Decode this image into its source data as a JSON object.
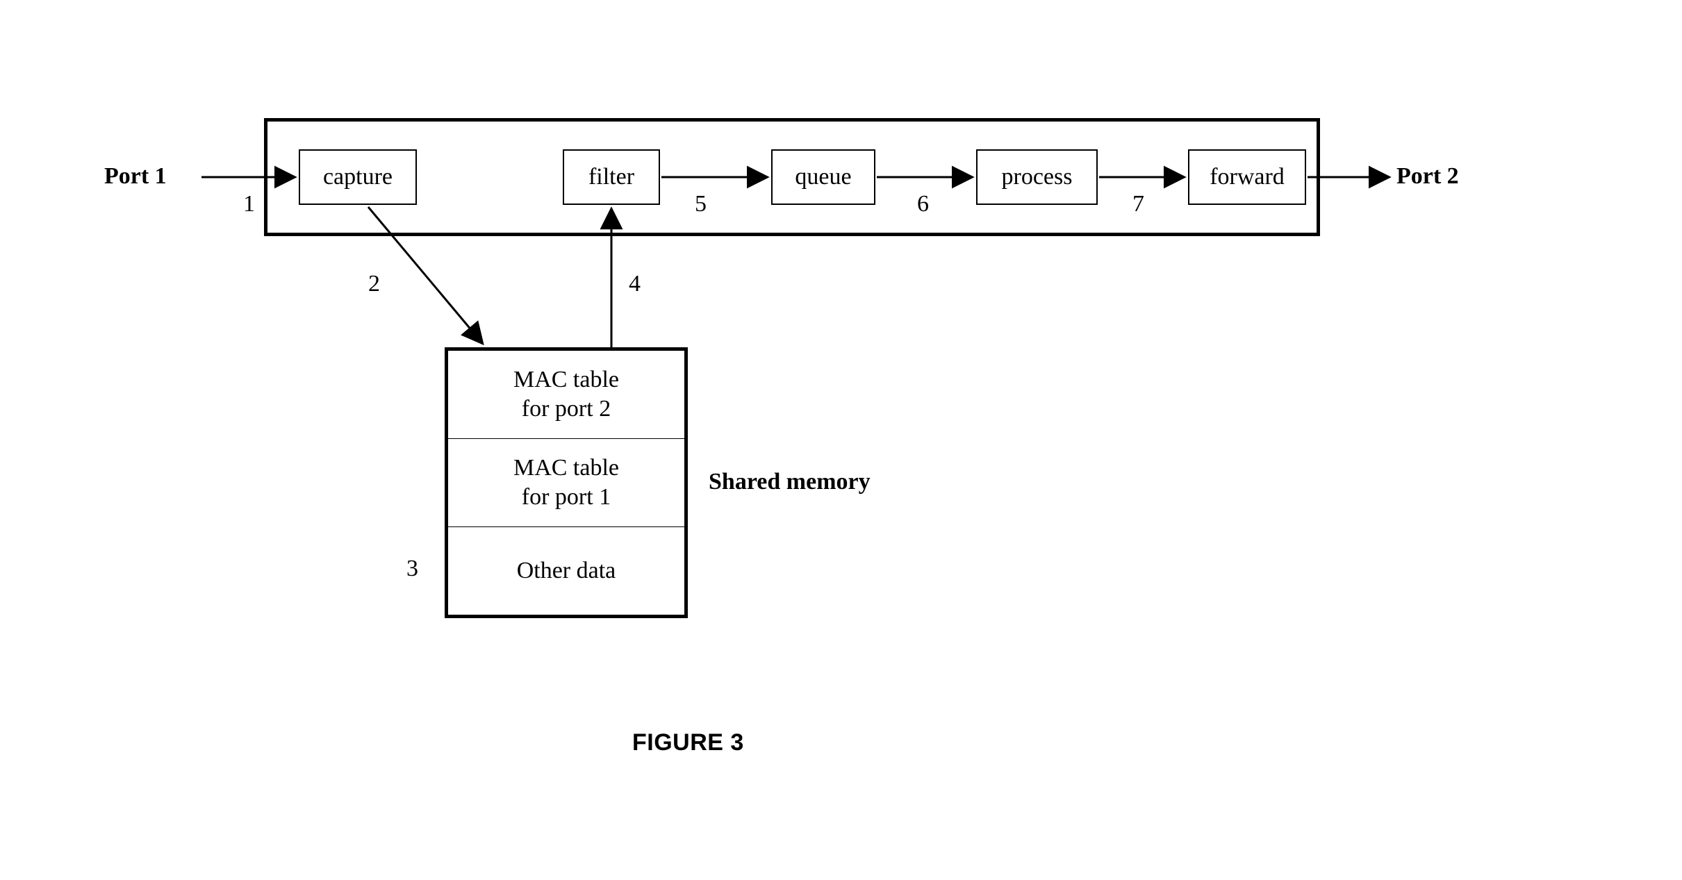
{
  "ports": {
    "left": "Port 1",
    "right": "Port 2"
  },
  "pipeline": {
    "capture": "capture",
    "filter": "filter",
    "queue": "queue",
    "process": "process",
    "forward": "forward"
  },
  "edge_labels": {
    "n1": "1",
    "n2": "2",
    "n3": "3",
    "n4": "4",
    "n5": "5",
    "n6": "6",
    "n7": "7"
  },
  "memory": {
    "row1": "MAC table\nfor port 2",
    "row2": "MAC table\nfor port 1",
    "row3": "Other data",
    "label": "Shared memory"
  },
  "caption": "FIGURE 3"
}
